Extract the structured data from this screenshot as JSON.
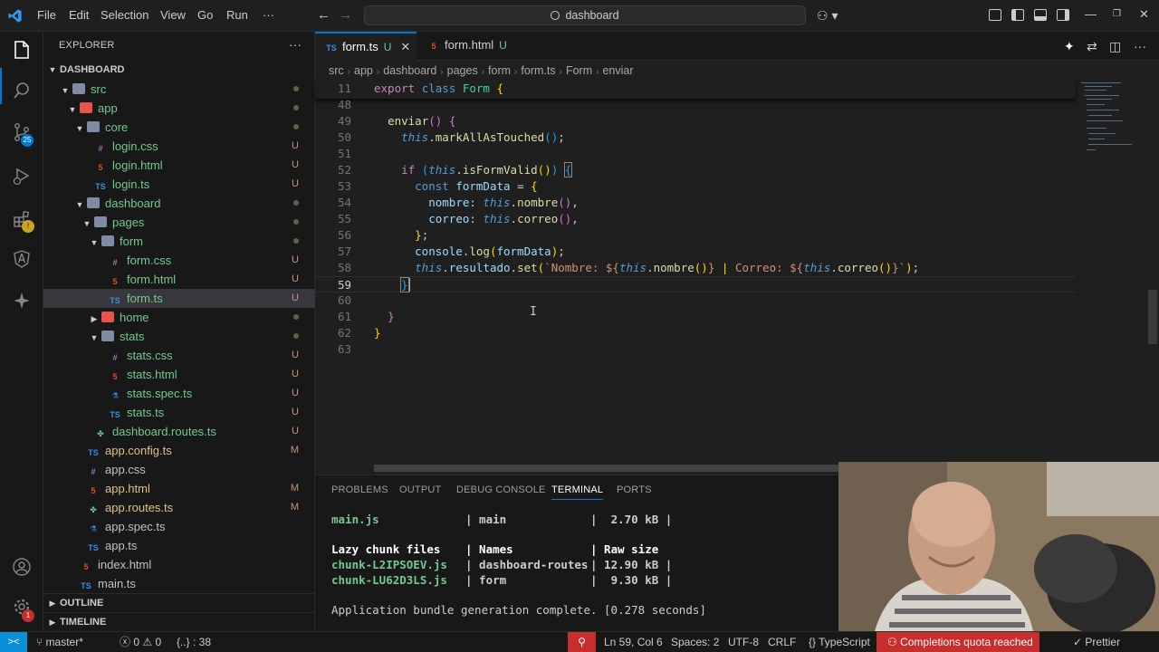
{
  "titlebar": {
    "menu": [
      "File",
      "Edit",
      "Selection",
      "View",
      "Go",
      "Run",
      "···"
    ],
    "search": "dashboard"
  },
  "activity": {
    "items": [
      "explorer-icon",
      "search-icon",
      "source-control-icon",
      "run-debug-icon",
      "extensions-icon",
      "angular-icon",
      "copilot-icon"
    ],
    "scm_badge": "25",
    "bottom": [
      "account-icon",
      "settings-icon"
    ],
    "settings_badge": "1"
  },
  "sidebar": {
    "title": "EXPLORER",
    "more": "···",
    "root": "DASHBOARD",
    "tree": [
      {
        "label": "src",
        "depth": 1,
        "kind": "folder-open",
        "status": "dot"
      },
      {
        "label": "app",
        "depth": 2,
        "kind": "folder-open",
        "status": "dot"
      },
      {
        "label": "core",
        "depth": 3,
        "kind": "folder-open",
        "status": "dot"
      },
      {
        "label": "login.css",
        "depth": 4,
        "kind": "css",
        "status": "U"
      },
      {
        "label": "login.html",
        "depth": 4,
        "kind": "html",
        "status": "U"
      },
      {
        "label": "login.ts",
        "depth": 4,
        "kind": "ts",
        "status": "U"
      },
      {
        "label": "dashboard",
        "depth": 3,
        "kind": "folder-open",
        "status": "dot"
      },
      {
        "label": "pages",
        "depth": 4,
        "kind": "folder-open",
        "status": "dot"
      },
      {
        "label": "form",
        "depth": 5,
        "kind": "folder-open",
        "status": "dot"
      },
      {
        "label": "form.css",
        "depth": 6,
        "kind": "css",
        "status": "U"
      },
      {
        "label": "form.html",
        "depth": 6,
        "kind": "html",
        "status": "U"
      },
      {
        "label": "form.ts",
        "depth": 6,
        "kind": "ts",
        "status": "U",
        "selected": true
      },
      {
        "label": "home",
        "depth": 5,
        "kind": "folder",
        "status": "dot"
      },
      {
        "label": "stats",
        "depth": 5,
        "kind": "folder-open",
        "status": "dot"
      },
      {
        "label": "stats.css",
        "depth": 6,
        "kind": "css",
        "status": "U"
      },
      {
        "label": "stats.html",
        "depth": 6,
        "kind": "html",
        "status": "U"
      },
      {
        "label": "stats.spec.ts",
        "depth": 6,
        "kind": "spec",
        "status": "U"
      },
      {
        "label": "stats.ts",
        "depth": 6,
        "kind": "ts",
        "status": "U"
      },
      {
        "label": "dashboard.routes.ts",
        "depth": 4,
        "kind": "routes",
        "status": "U"
      },
      {
        "label": "app.config.ts",
        "depth": 3,
        "kind": "ts",
        "status": "M"
      },
      {
        "label": "app.css",
        "depth": 3,
        "kind": "css",
        "status": ""
      },
      {
        "label": "app.html",
        "depth": 3,
        "kind": "html",
        "status": "M"
      },
      {
        "label": "app.routes.ts",
        "depth": 3,
        "kind": "routes",
        "status": "M"
      },
      {
        "label": "app.spec.ts",
        "depth": 3,
        "kind": "spec",
        "status": ""
      },
      {
        "label": "app.ts",
        "depth": 3,
        "kind": "ts",
        "status": ""
      },
      {
        "label": "index.html",
        "depth": 2,
        "kind": "html",
        "status": ""
      },
      {
        "label": "main.ts",
        "depth": 2,
        "kind": "ts",
        "status": ""
      }
    ],
    "outline": "OUTLINE",
    "timeline": "TIMELINE"
  },
  "tabs": [
    {
      "label": "form.ts",
      "type": "TS",
      "status": "U",
      "active": true
    },
    {
      "label": "form.html",
      "type": "html",
      "status": "U",
      "active": false
    }
  ],
  "breadcrumb": [
    "src",
    "app",
    "dashboard",
    "pages",
    "form",
    "form.ts",
    "Form",
    "enviar"
  ],
  "code": {
    "sticky": {
      "ln": "11"
    },
    "lines": [
      {
        "ln": "48"
      },
      {
        "ln": "49"
      },
      {
        "ln": "50"
      },
      {
        "ln": "51"
      },
      {
        "ln": "52"
      },
      {
        "ln": "53"
      },
      {
        "ln": "54"
      },
      {
        "ln": "55"
      },
      {
        "ln": "56"
      },
      {
        "ln": "57"
      },
      {
        "ln": "58"
      },
      {
        "ln": "59"
      },
      {
        "ln": "60"
      },
      {
        "ln": "61"
      },
      {
        "ln": "62"
      },
      {
        "ln": "63"
      }
    ]
  },
  "panel": {
    "tabs": [
      "PROBLEMS",
      "OUTPUT",
      "DEBUG CONSOLE",
      "TERMINAL",
      "PORTS"
    ],
    "active_tab": "TERMINAL",
    "terminal": {
      "main_row": [
        "main.js",
        "| main",
        "|  2.70 kB |"
      ],
      "header": [
        "Lazy chunk files",
        "| Names",
        "| Raw size"
      ],
      "chunks": [
        [
          "chunk-L2IPSOEV.js",
          "| dashboard-routes",
          "| 12.90 kB |"
        ],
        [
          "chunk-LU62D3LS.js",
          "| form",
          "|  9.30 kB |"
        ]
      ],
      "complete": "Application bundle generation complete. [0.278 seconds]"
    }
  },
  "statusbar": {
    "remote": "><",
    "branch": "master*",
    "problems": "0",
    "warnings": "0",
    "selection": "{..} : 38",
    "position": "Ln 59, Col 6",
    "spaces": "Spaces: 2",
    "encoding": "UTF-8",
    "eol": "CRLF",
    "language": "TypeScript",
    "quota": "Completions quota reached",
    "prettier": "Prettier"
  },
  "colors": {
    "accent": "#0078d4",
    "error": "#c72e2e",
    "untracked": "#73c991",
    "modified": "#e2c08d"
  }
}
